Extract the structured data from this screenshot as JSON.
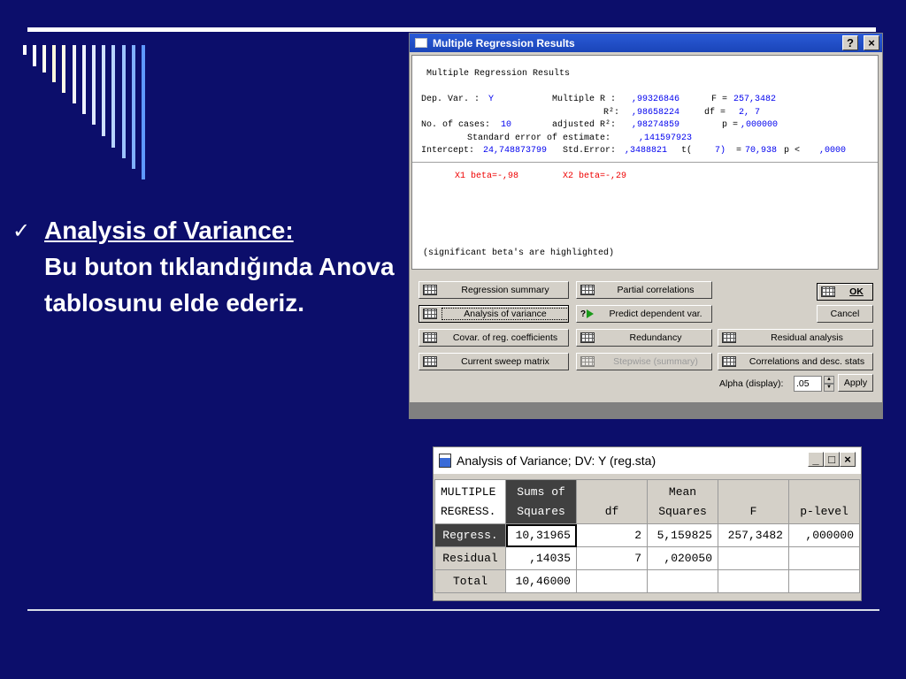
{
  "slide": {
    "bullet_mark": "✓",
    "heading": "Analysis of Variance:",
    "body": "Bu buton tıklandığında Anova tablosunu elde ederiz."
  },
  "regression_window": {
    "title": "Multiple Regression Results",
    "help_btn": "?",
    "close_btn": "×",
    "output": {
      "header": "Multiple Regression Results",
      "dep_var_label": "Dep. Var. :",
      "dep_var": "Y",
      "multiple_r_label": "Multiple R :",
      "multiple_r": ",99326846",
      "f_label": "F =",
      "f_value": "257,3482",
      "r2_label": "R²:",
      "r2": ",98658224",
      "df_label": "df =",
      "df_value1": "2,",
      "df_value2": "7",
      "cases_label": "No. of cases:",
      "cases": "10",
      "adj_r2_label": "adjusted R²:",
      "adj_r2": ",98274859",
      "p_label": "p =",
      "p_value": ",000000",
      "se_label": "Standard error of estimate:",
      "se_value": ",141597923",
      "intercept_label": "Intercept:",
      "intercept": "24,748873799",
      "stderr_label": "Std.Error:",
      "stderr": ",3488821",
      "t_label": "t(",
      "t_df": "7)",
      "t_eq": "=",
      "t_value": "70,938",
      "p2_label": "p <",
      "p2_value": ",0000",
      "beta1": "X1 beta=-,98",
      "beta2": "X2 beta=-,29",
      "note": "(significant beta's are highlighted)"
    },
    "buttons": {
      "regression_summary": "Regression summary",
      "analysis_of_variance": "Analysis of variance",
      "covar": "Covar. of reg. coefficients",
      "sweep": "Current sweep matrix",
      "partial": "Partial correlations",
      "predict": "Predict dependent var.",
      "redundancy": "Redundancy",
      "stepwise": "Stepwise (summary)",
      "ok": "OK",
      "cancel": "Cancel",
      "residual": "Residual analysis",
      "correlations": "Correlations and desc. stats",
      "alpha_label": "Alpha (display):",
      "alpha_value": ".05",
      "apply": "Apply"
    }
  },
  "anova_window": {
    "title": "Analysis of Variance; DV: Y (reg.sta)",
    "min_btn": "_",
    "max_btn": "□",
    "close_btn": "×",
    "corner_line1": "MULTIPLE",
    "corner_line2": "REGRESS.",
    "headers": [
      {
        "l1": "Sums of",
        "l2": "Squares"
      },
      {
        "l1": "",
        "l2": "df"
      },
      {
        "l1": "Mean",
        "l2": "Squares"
      },
      {
        "l1": "",
        "l2": "F"
      },
      {
        "l1": "",
        "l2": "p-level"
      }
    ],
    "rows": [
      {
        "label": "Regress.",
        "cells": [
          "10,31965",
          "2",
          "5,159825",
          "257,3482",
          ",000000"
        ]
      },
      {
        "label": "Residual",
        "cells": [
          ",14035",
          "7",
          ",020050",
          "",
          ""
        ]
      },
      {
        "label": "Total",
        "cells": [
          "10,46000",
          "",
          "",
          "",
          ""
        ]
      }
    ]
  },
  "colors": {
    "slide_bg": "#0c0e6b",
    "title_blue": "#2a5bd7",
    "value_blue": "#0000ee",
    "beta_red": "#ee0000"
  }
}
